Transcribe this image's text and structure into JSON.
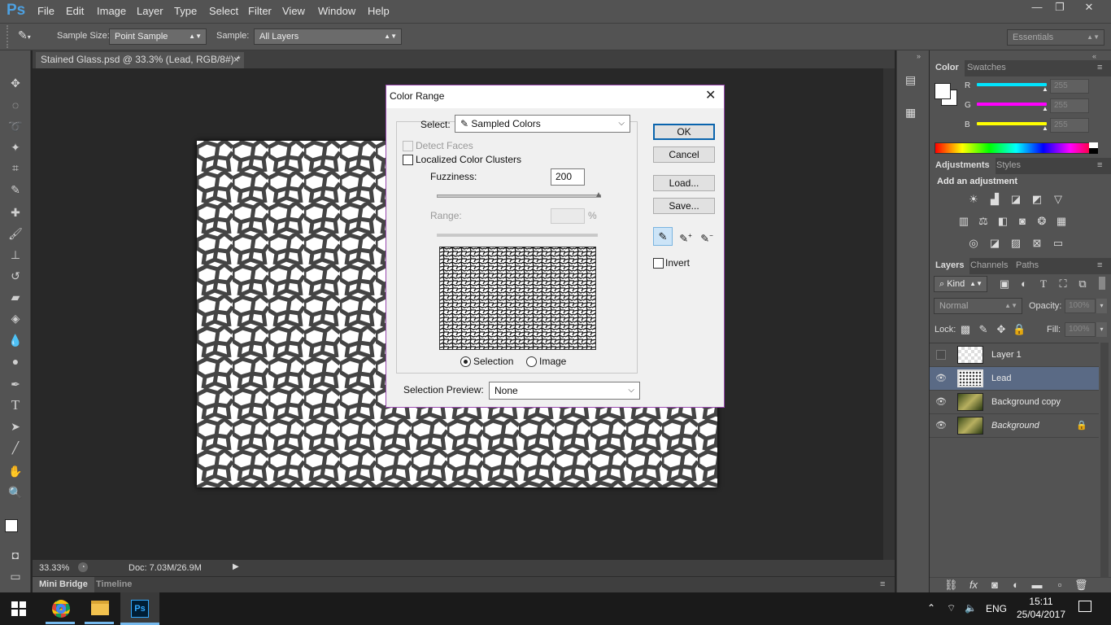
{
  "app": {
    "logo": "Ps"
  },
  "menu": [
    "File",
    "Edit",
    "Image",
    "Layer",
    "Type",
    "Select",
    "Filter",
    "View",
    "Window",
    "Help"
  ],
  "window_controls": {
    "minimize": "—",
    "restore": "❐",
    "close": "✕"
  },
  "options": {
    "sample_size_label": "Sample Size:",
    "sample_size_value": "Point Sample",
    "sample_label": "Sample:",
    "sample_value": "All Layers",
    "workspace": "Essentials"
  },
  "document": {
    "tab_title": "Stained Glass.psd @ 33.3% (Lead, RGB/8#) *",
    "tab_close": "×"
  },
  "status": {
    "zoom": "33.33%",
    "doc": "Doc: 7.03M/26.9M"
  },
  "bottom_tabs": {
    "mini_bridge": "Mini Bridge",
    "timeline": "Timeline"
  },
  "color_panel": {
    "tabs": [
      "Color",
      "Swatches"
    ],
    "channels": [
      {
        "label": "R",
        "value": "255",
        "color": "#00e5ff"
      },
      {
        "label": "G",
        "value": "255",
        "color": "#ff00ff"
      },
      {
        "label": "B",
        "value": "255",
        "color": "#ffff00"
      }
    ]
  },
  "adjustments_panel": {
    "tabs": [
      "Adjustments",
      "Styles"
    ],
    "heading": "Add an adjustment"
  },
  "layers_panel": {
    "tabs": [
      "Layers",
      "Channels",
      "Paths"
    ],
    "filter_kind": "Kind",
    "blend_mode": "Normal",
    "opacity_label": "Opacity:",
    "opacity_value": "100%",
    "lock_label": "Lock:",
    "fill_label": "Fill:",
    "fill_value": "100%",
    "layers": [
      {
        "name": "Layer 1",
        "visible": false,
        "selected": false
      },
      {
        "name": "Lead",
        "visible": true,
        "selected": true
      },
      {
        "name": "Background copy",
        "visible": true,
        "selected": false
      },
      {
        "name": "Background",
        "visible": true,
        "selected": false,
        "locked": true
      }
    ]
  },
  "dialog": {
    "title": "Color Range",
    "select_label": "Select:",
    "select_value": "Sampled Colors",
    "detect_faces": "Detect Faces",
    "localized_clusters": "Localized Color Clusters",
    "fuzziness_label": "Fuzziness:",
    "fuzziness_value": "200",
    "fuzziness": 1.0,
    "range_label": "Range:",
    "range_unit": "%",
    "radio_selection": "Selection",
    "radio_image": "Image",
    "preview_label": "Selection Preview:",
    "preview_value": "None",
    "ok": "OK",
    "cancel": "Cancel",
    "load": "Load...",
    "save": "Save...",
    "invert": "Invert"
  },
  "taskbar": {
    "lang": "ENG",
    "time": "15:11",
    "date": "25/04/2017"
  }
}
